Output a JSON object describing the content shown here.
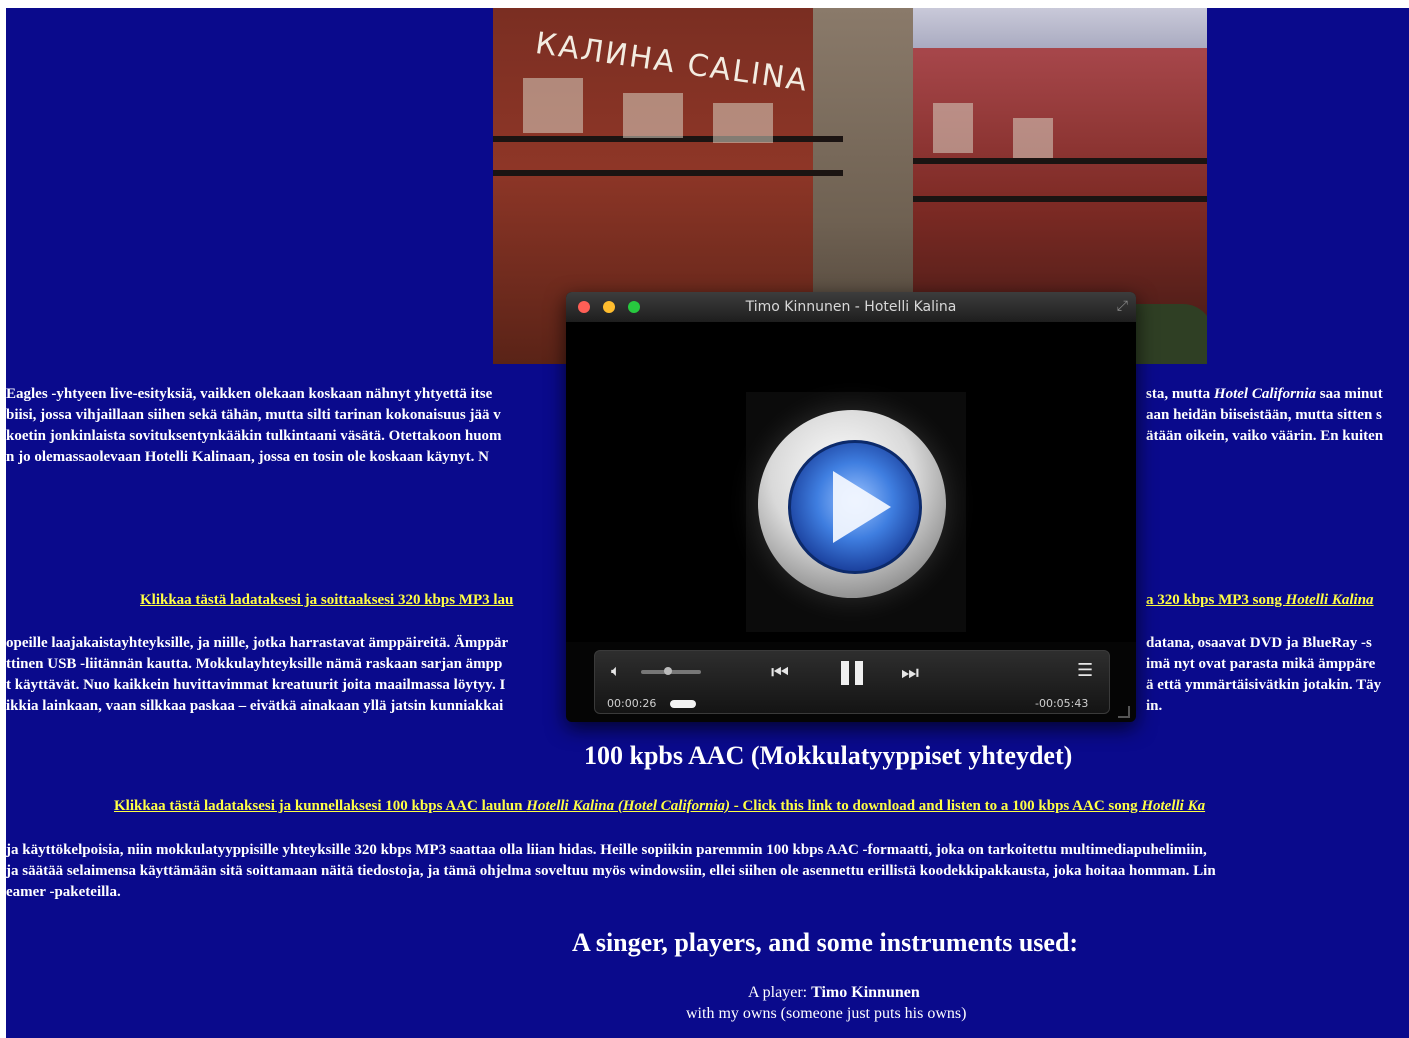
{
  "hero": {
    "sign_text": "КАЛИНА CALINA",
    "sign_text_2": "CALINA"
  },
  "intro": {
    "line1_left": "Eagles -yhtyeen live-esityksiä, vaikken olekaan koskaan nähnyt yhtyettä itse",
    "line1_right": "sta, mutta ",
    "line1_right_italic": "Hotel California",
    "line1_right_tail": " saa minut",
    "line2_left": "biisi, jossa vihjaillaan siihen sekä tähän, mutta silti tarinan kokonaisuus jää v",
    "line2_right": "aan heidän biiseistään, mutta sitten s",
    "line3_left": "koetin jonkinlaista sovituksentynkääkin tulkintaani väsätä. Otettakoon huom",
    "line3_right": "ätään oikein, vaiko väärin. En kuiten",
    "line4_left": "n jo olemassaolevaan Hotelli Kalinaan, jossa en tosin ole koskaan käynyt. N"
  },
  "mp3_link": {
    "left": "Klikkaa tästä ladataksesi ja soittaaksesi 320 kbps MP3 lau",
    "right": "a 320 kbps MP3 song ",
    "right_italic": "Hotelli Kalina"
  },
  "mp3_para": {
    "line1_left": "opeille laajakaistayhteyksille, ja niille, jotka harrastavat ämppäireitä. Ämppär",
    "line1_right": "datana, osaavat DVD ja BlueRay -s",
    "line2_left": "ttinen USB -liitännän kautta. Mokkulayhteyksille nämä raskaan sarjan ämpp",
    "line2_right": "imä nyt ovat parasta mikä ämppäre",
    "line3_left": "t käyttävät. Nuo kaikkein huvittavimmat kreatuurit joita maailmassa löytyy. I",
    "line3_right": "ä että ymmärtäisivätkin jotakin. Täy",
    "line4_left": "ikkia lainkaan, vaan silkkaa paskaa – eivätkä ainakaan yllä jatsin kunniakkai",
    "line4_right": "in."
  },
  "aac_heading": "100 kpbs AAC (Mokkulatyyppiset yhteydet)",
  "aac_link": {
    "prefix": "Klikkaa tästä ladataksesi ja kunnellaksesi 100 kbps AAC laulun ",
    "italic": "Hotelli Kalina (Hotel California)",
    "middle": " - Click this link to download and listen to a 100 kbps AAC song ",
    "tail_italic": "Hotelli Ka"
  },
  "aac_para": {
    "line1": "ja käyttökelpoisia, niin mokkulatyyppisille yhteyksille 320 kbps MP3 saattaa olla liian hidas. Heille sopiikin paremmin 100 kbps AAC -formaatti, joka on tarkoitettu multimediapuhelimiin,",
    "line2": "ja säätää selaimensa käyttämään sitä soittamaan näitä tiedostoja, ja tämä ohjelma soveltuu myös windowsiin, ellei siihen ole asennettu erillistä koodekkipakkausta, joka hoitaa homman. Lin",
    "line3": "eamer -paketeilla."
  },
  "singer_heading": "A singer, players, and some instruments used:",
  "player_line_label": "A player: ",
  "player_line_name": "Timo Kinnunen",
  "player_line_2": "with my owns (someone just puts his owns)",
  "media_player": {
    "title": "Timo Kinnunen - Hotelli Kalina",
    "elapsed": "00:00:26",
    "remaining": "-00:05:43",
    "volume_level": 0.45,
    "progress": 0.07,
    "colors": {
      "close": "#ff5f56",
      "minimize": "#ffbd2e",
      "zoom": "#27c93f"
    }
  }
}
